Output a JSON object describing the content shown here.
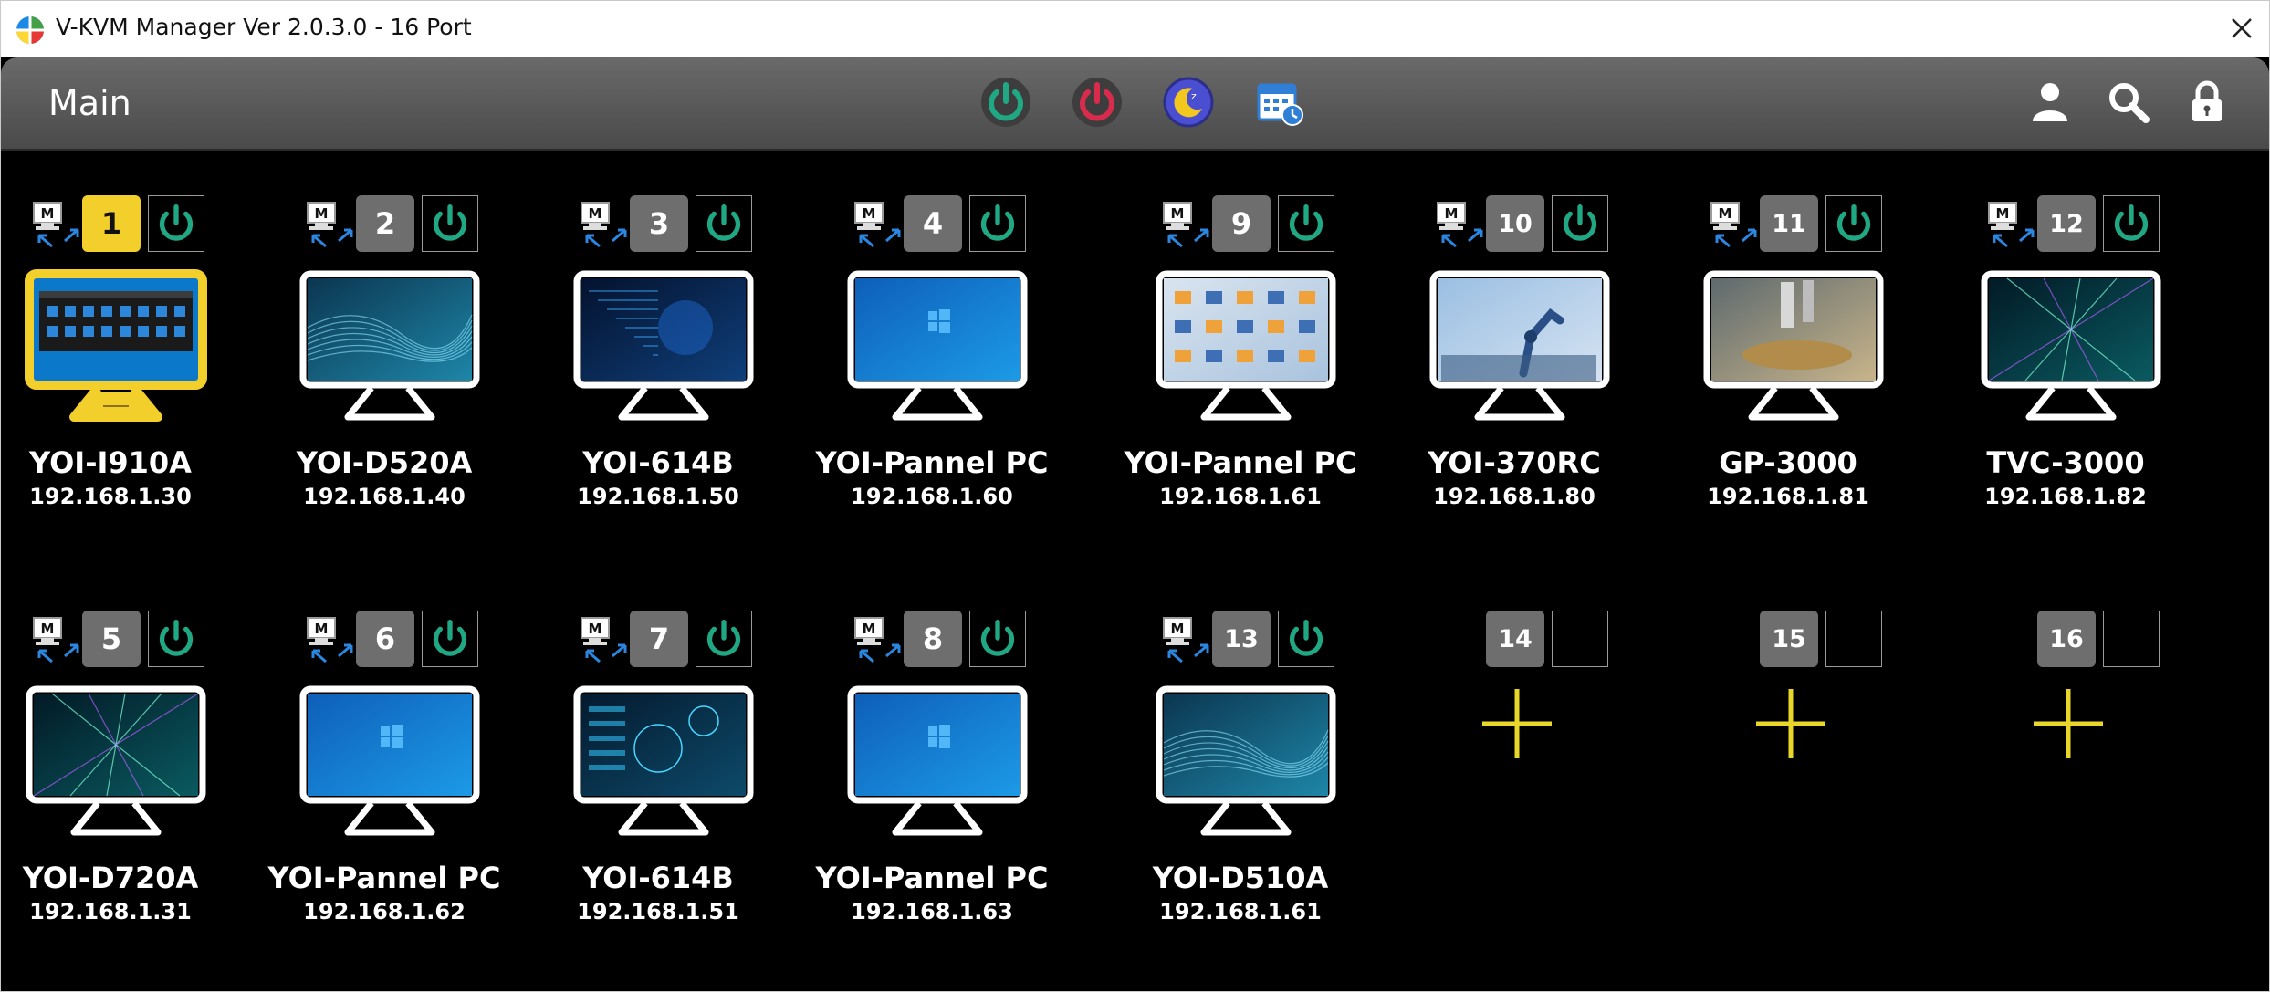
{
  "window": {
    "title": "V-KVM Manager Ver 2.0.3.0 - 16 Port"
  },
  "header": {
    "title": "Main"
  },
  "colors": {
    "active_badge": "#f2cf2a",
    "power_on": "#1fa883",
    "power_off": "#d92c4c",
    "add_plus": "#e8d62a",
    "header_bg": "#5a5a5a"
  },
  "toolbar": [
    "power-on-all-icon",
    "power-off-all-icon",
    "sleep-icon",
    "schedule-icon"
  ],
  "header_right": [
    "user-icon",
    "search-icon",
    "lock-icon"
  ],
  "ports": [
    {
      "number": "1",
      "name": "YOI-I910A",
      "ip": "192.168.1.30",
      "active": true,
      "screen": "desktop"
    },
    {
      "number": "2",
      "name": "YOI-D520A",
      "ip": "192.168.1.40",
      "screen": "wave"
    },
    {
      "number": "3",
      "name": "YOI-614B",
      "ip": "192.168.1.50",
      "screen": "circuit"
    },
    {
      "number": "4",
      "name": "YOI-Pannel PC",
      "ip": "192.168.1.60",
      "screen": "windows"
    },
    {
      "number": "9",
      "name": "YOI-Pannel PC",
      "ip": "192.168.1.61",
      "screen": "factory"
    },
    {
      "number": "10",
      "name": "YOI-370RC",
      "ip": "192.168.1.80",
      "screen": "robot"
    },
    {
      "number": "11",
      "name": "GP-3000",
      "ip": "192.168.1.81",
      "screen": "microscope"
    },
    {
      "number": "12",
      "name": "TVC-3000",
      "ip": "192.168.1.82",
      "screen": "tunnel"
    },
    {
      "number": "5",
      "name": "YOI-D720A",
      "ip": "192.168.1.31",
      "screen": "tunnel"
    },
    {
      "number": "6",
      "name": "YOI-Pannel PC",
      "ip": "192.168.1.62",
      "screen": "windows"
    },
    {
      "number": "7",
      "name": "YOI-614B",
      "ip": "192.168.1.51",
      "screen": "hud"
    },
    {
      "number": "8",
      "name": "YOI-Pannel PC",
      "ip": "192.168.1.63",
      "screen": "windows"
    },
    {
      "number": "13",
      "name": "YOI-D510A",
      "ip": "192.168.1.61",
      "screen": "wave"
    },
    {
      "number": "14",
      "empty": true
    },
    {
      "number": "15",
      "empty": true
    },
    {
      "number": "16",
      "empty": true
    }
  ]
}
